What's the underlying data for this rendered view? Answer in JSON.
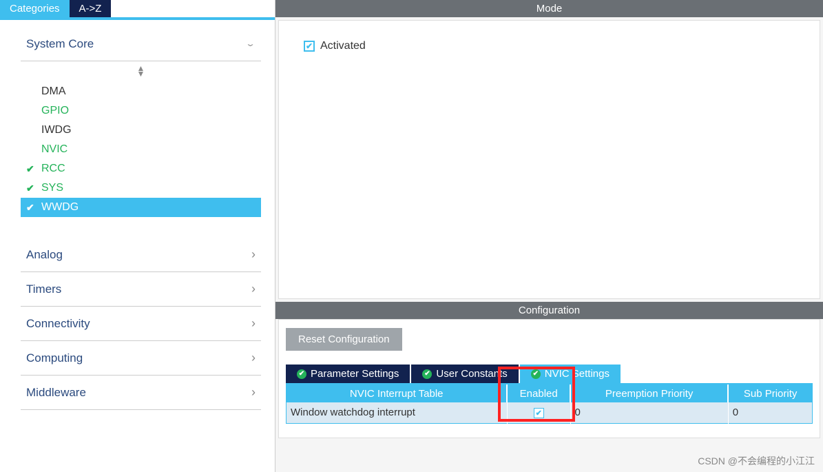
{
  "sidebar": {
    "tabs": {
      "categories": "Categories",
      "az": "A->Z"
    },
    "sections": {
      "system_core": "System Core",
      "analog": "Analog",
      "timers": "Timers",
      "connectivity": "Connectivity",
      "computing": "Computing",
      "middleware": "Middleware"
    },
    "tree": {
      "dma": "DMA",
      "gpio": "GPIO",
      "iwdg": "IWDG",
      "nvic": "NVIC",
      "rcc": "RCC",
      "sys": "SYS",
      "wwdg": "WWDG"
    }
  },
  "right": {
    "mode_title": "Mode",
    "activated_label": "Activated",
    "config_title": "Configuration",
    "reset_btn": "Reset Configuration",
    "tabs": {
      "param": "Parameter Settings",
      "user_const": "User Constants",
      "nvic": "NVIC Settings"
    },
    "table": {
      "headers": {
        "name": "NVIC Interrupt Table",
        "enabled": "Enabled",
        "preempt": "Preemption Priority",
        "sub": "Sub Priority"
      },
      "row0": {
        "name": "Window watchdog interrupt",
        "preempt": "0",
        "sub": "0"
      }
    }
  },
  "caption": "CSDN @不会编程的小江江"
}
